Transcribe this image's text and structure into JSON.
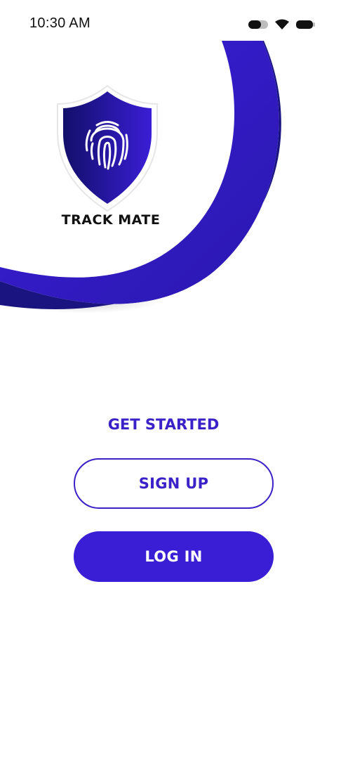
{
  "status_bar": {
    "time": "10:30 AM",
    "icons": [
      "toggle-icon",
      "wifi-icon",
      "battery-icon"
    ]
  },
  "brand": {
    "name": "TRACK MATE",
    "logo": "shield-fingerprint-icon"
  },
  "auth": {
    "heading": "GET STARTED",
    "signup_label": "SIGN UP",
    "login_label": "LOG IN"
  },
  "colors": {
    "primary": "#3a1ed6",
    "dark_navy": "#1a1480",
    "text": "#111111",
    "background": "#ffffff"
  }
}
